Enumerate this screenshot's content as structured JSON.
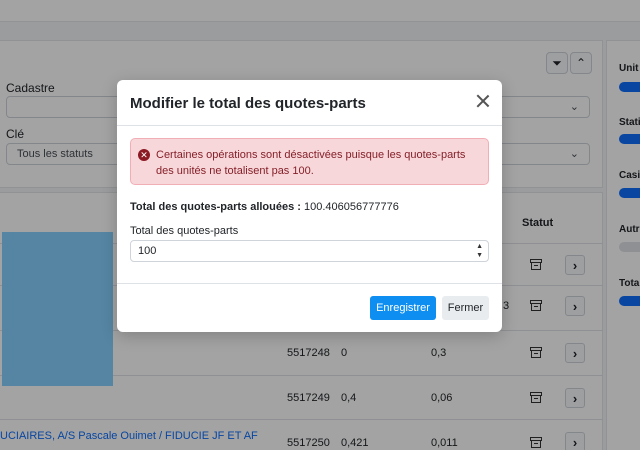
{
  "background": {
    "filters": {
      "cadastre_label": "Cadastre",
      "cadastre_value": "",
      "cle_label": "Clé",
      "cle_value": "Tous les statuts"
    },
    "table": {
      "status_header": "Statut",
      "rows": [
        {
          "id": "",
          "a": "",
          "b": "3"
        },
        {
          "id": "5517248",
          "a": "0",
          "b": "0,3"
        },
        {
          "id": "5517249",
          "a": "0,4",
          "b": "0,06"
        },
        {
          "id": "5517250",
          "a": "0,421",
          "b": "0,011",
          "name": "UCIAIRES, A/S Pascale Ouimet / FIDUCIE JF ET AF"
        }
      ]
    },
    "side_panel": {
      "labels": [
        "Unit",
        "Stati",
        "Casi",
        "Autr",
        "Tota"
      ]
    }
  },
  "modal": {
    "title": "Modifier le total des quotes-parts",
    "alert_text": "Certaines opérations sont désactivées puisque les quotes-parts des unités ne totalisent pas 100.",
    "allocated_label": "Total des quotes-parts allouées :",
    "allocated_value": "100.406056777776",
    "field_label": "Total des quotes-parts",
    "field_value": "100",
    "save_label": "Enregistrer",
    "close_label": "Fermer"
  },
  "colors": {
    "primary": "#0d8ef0",
    "alert_bg": "#f8d7da",
    "alert_text": "#842029",
    "redaction": "#86d0ff"
  }
}
